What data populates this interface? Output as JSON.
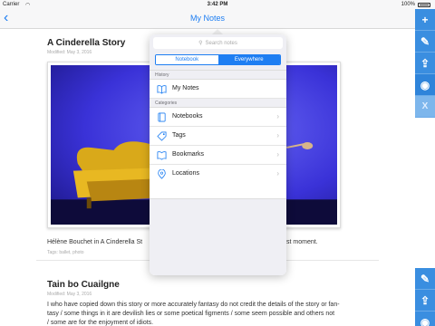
{
  "status": {
    "carrier": "Carrier",
    "time": "3:42 PM",
    "battery": "100%"
  },
  "nav": {
    "title": "My Notes",
    "back": "‹"
  },
  "rail_top": [
    {
      "name": "add-icon",
      "glyph": "+"
    },
    {
      "name": "edit-icon",
      "glyph": "✎"
    },
    {
      "name": "share-icon",
      "glyph": "⇪"
    },
    {
      "name": "eye-icon",
      "glyph": "◉"
    },
    {
      "name": "close-icon",
      "glyph": "X"
    }
  ],
  "rail_bottom": [
    {
      "name": "edit-icon",
      "glyph": "✎"
    },
    {
      "name": "share-icon",
      "glyph": "⇪"
    },
    {
      "name": "eye-icon",
      "glyph": "◉"
    }
  ],
  "note1": {
    "title": "A Cinderella Story",
    "meta": "Modified: May 3, 2016",
    "caption_left": "Hélène Bouchet in A Cinderella St",
    "caption_right": "st moment.",
    "tags": "Tags:  ballet, photo"
  },
  "note2": {
    "title": "Tain bo Cuailgne",
    "meta": "Modified: May 3, 2016",
    "lines": [
      "I who have copied down this story or more accurately fantasy do not credit the details of the story or fan-",
      "tasy / some things in it are devilish lies or some poetical figments / some seem possible and others not",
      "/ some are for the enjoyment of idiots."
    ]
  },
  "popover": {
    "search_placeholder": "Search notes",
    "segments": [
      "Notebook",
      "Everywhere"
    ],
    "selected_segment": "Everywhere",
    "history_header": "History",
    "history_items": [
      {
        "label": "My Notes",
        "icon": "book-icon"
      }
    ],
    "categories_header": "Categories",
    "category_items": [
      {
        "label": "Notebooks",
        "icon": "notebooks-icon"
      },
      {
        "label": "Tags",
        "icon": "tag-icon"
      },
      {
        "label": "Bookmarks",
        "icon": "bookmark-icon"
      },
      {
        "label": "Locations",
        "icon": "location-icon"
      }
    ]
  },
  "colors": {
    "accent": "#1e7ef2",
    "rail": "#3a8ee0"
  }
}
